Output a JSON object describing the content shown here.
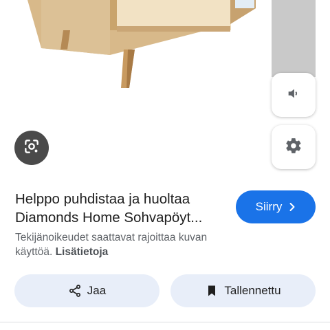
{
  "result": {
    "title_lines": [
      "Helppo puhdistaa ja huoltaa",
      "Diamonds Home Sohvapöyt..."
    ],
    "visit_label": "Siirry",
    "copyright_lines": [
      "Tekijänoikeudet saattavat rajoittaa kuvan",
      "käyttöä."
    ],
    "learn_more_label": "Lisätietoja"
  },
  "actions": {
    "share_label": "Jaa",
    "save_label": "Tallennettu"
  },
  "icons": {
    "lens": "google-lens-icon",
    "volume": "volume-icon",
    "settings": "gear-icon",
    "visit": "chevron-right-icon",
    "share": "share-icon",
    "save": "bookmark-icon"
  },
  "colors": {
    "accent": "#1a73e8",
    "action_bg": "#e8eef9",
    "muted_text": "#5f6368"
  }
}
